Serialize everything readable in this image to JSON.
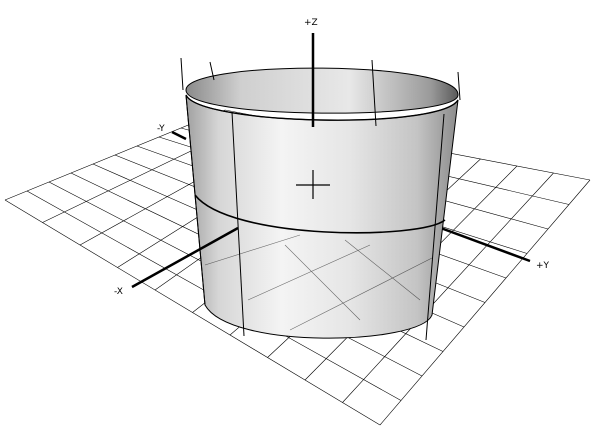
{
  "viewport": {
    "axis_labels": {
      "pos_z": "+Z",
      "neg_y": "-Y",
      "pos_y": "+Y",
      "neg_x": "-X"
    },
    "colors": {
      "background": "#ffffff",
      "grid": "#000000",
      "axis": "#000000",
      "surface_light": "#f2f2f2",
      "surface_dark": "#9a9a9a",
      "surface_inner": "#6a6a6a"
    },
    "object": "cylinder-surface",
    "grid_divisions": 10
  }
}
